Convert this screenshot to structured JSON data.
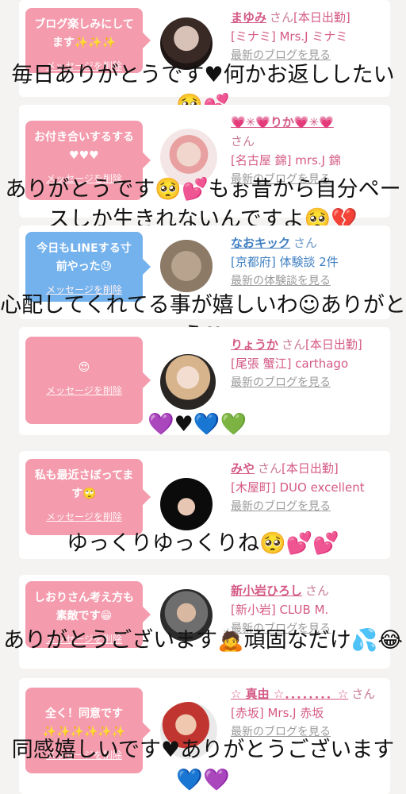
{
  "messages": [
    {
      "bubble": "ブログ楽しみにしてます✨✨✨",
      "delete_label": "メッセージを削除",
      "name": "まゆみ",
      "honorific": "さん",
      "status": "[本日出勤]",
      "shop": "[ミナミ] Mrs.J ミナミ",
      "latest": "最新のブログを見る",
      "overlay": "毎日ありがとうです♥何かお返ししたい🥺💕"
    },
    {
      "bubble": "お付き合いするする♥♥♥",
      "delete_label": "メッセージを削除",
      "name": "💗✳💗りか💗✳💗",
      "honorific": "さん",
      "status": "",
      "shop": "[名古屋 錦] mrs.J 錦",
      "latest": "最新のブログを見る",
      "overlay": "ありがとうです🥺💕もぉ昔から自分ペースしか生きれないんですよ🥺💔"
    },
    {
      "bubble": "今日もLINEする寸前やった😓",
      "delete_label": "メッセージを削除",
      "name": "なおキック",
      "honorific": "さん",
      "status": "",
      "shop": "[京都府] 体験談 2件",
      "latest": "最新の体験談を見る",
      "overlay": "心配してくれてる事が嬉しいわ☺ありがとう♥"
    },
    {
      "bubble": "😍",
      "delete_label": "メッセージを削除",
      "name": "りょうか",
      "honorific": "さん",
      "status": "[本日出勤]",
      "shop": "[尾張 蟹江] carthago",
      "latest": "最新のブログを見る",
      "overlay": "💜♥💙💚"
    },
    {
      "bubble": "私も最近さぼってます🙄",
      "delete_label": "メッセージを削除",
      "name": "みや",
      "honorific": "さん",
      "status": "[本日出勤]",
      "shop": "[木屋町] DUO excellent",
      "latest": "最新のブログを見る",
      "overlay": "ゆっくりゆっくりね🥺💕💕"
    },
    {
      "bubble": "しおりさん考え方も素敵です😁",
      "delete_label": "メッセージを削除",
      "name": "新小岩ひろし",
      "honorific": "さん",
      "status": "",
      "shop": "[新小岩] CLUB M.",
      "latest": "最新のブログを見る",
      "overlay": "ありがとうございます🙇頑固なだけ💦😂"
    },
    {
      "bubble": "全く！同意です✨✨✨✨✨✨",
      "delete_label": "メッセージを削除",
      "name": "☆ 真由 ☆．．．．．．．．☆",
      "honorific": "さん",
      "status": "",
      "shop": "[赤坂] Mrs.J 赤坂",
      "latest": "最新のブログを見る",
      "overlay": "同感嬉しいです♥ありがとうございます💙💜"
    }
  ],
  "colors": {
    "pink_bubble": "#f49cad",
    "blue_bubble": "#74b2ed",
    "pink_text": "#d45a86",
    "blue_text": "#3f7fc2"
  }
}
